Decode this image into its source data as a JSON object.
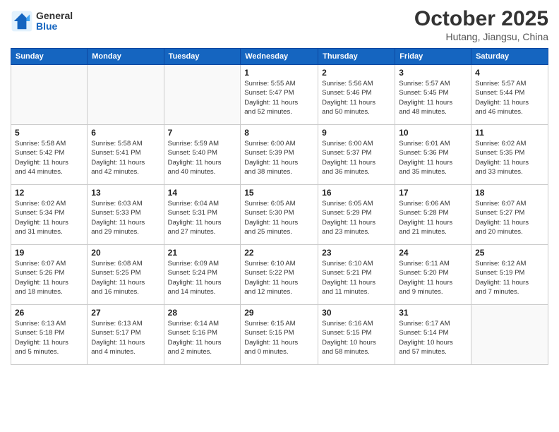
{
  "logo": {
    "general": "General",
    "blue": "Blue"
  },
  "title": "October 2025",
  "location": "Hutang, Jiangsu, China",
  "weekdays": [
    "Sunday",
    "Monday",
    "Tuesday",
    "Wednesday",
    "Thursday",
    "Friday",
    "Saturday"
  ],
  "weeks": [
    [
      {
        "day": "",
        "info": ""
      },
      {
        "day": "",
        "info": ""
      },
      {
        "day": "",
        "info": ""
      },
      {
        "day": "1",
        "info": "Sunrise: 5:55 AM\nSunset: 5:47 PM\nDaylight: 11 hours\nand 52 minutes."
      },
      {
        "day": "2",
        "info": "Sunrise: 5:56 AM\nSunset: 5:46 PM\nDaylight: 11 hours\nand 50 minutes."
      },
      {
        "day": "3",
        "info": "Sunrise: 5:57 AM\nSunset: 5:45 PM\nDaylight: 11 hours\nand 48 minutes."
      },
      {
        "day": "4",
        "info": "Sunrise: 5:57 AM\nSunset: 5:44 PM\nDaylight: 11 hours\nand 46 minutes."
      }
    ],
    [
      {
        "day": "5",
        "info": "Sunrise: 5:58 AM\nSunset: 5:42 PM\nDaylight: 11 hours\nand 44 minutes."
      },
      {
        "day": "6",
        "info": "Sunrise: 5:58 AM\nSunset: 5:41 PM\nDaylight: 11 hours\nand 42 minutes."
      },
      {
        "day": "7",
        "info": "Sunrise: 5:59 AM\nSunset: 5:40 PM\nDaylight: 11 hours\nand 40 minutes."
      },
      {
        "day": "8",
        "info": "Sunrise: 6:00 AM\nSunset: 5:39 PM\nDaylight: 11 hours\nand 38 minutes."
      },
      {
        "day": "9",
        "info": "Sunrise: 6:00 AM\nSunset: 5:37 PM\nDaylight: 11 hours\nand 36 minutes."
      },
      {
        "day": "10",
        "info": "Sunrise: 6:01 AM\nSunset: 5:36 PM\nDaylight: 11 hours\nand 35 minutes."
      },
      {
        "day": "11",
        "info": "Sunrise: 6:02 AM\nSunset: 5:35 PM\nDaylight: 11 hours\nand 33 minutes."
      }
    ],
    [
      {
        "day": "12",
        "info": "Sunrise: 6:02 AM\nSunset: 5:34 PM\nDaylight: 11 hours\nand 31 minutes."
      },
      {
        "day": "13",
        "info": "Sunrise: 6:03 AM\nSunset: 5:33 PM\nDaylight: 11 hours\nand 29 minutes."
      },
      {
        "day": "14",
        "info": "Sunrise: 6:04 AM\nSunset: 5:31 PM\nDaylight: 11 hours\nand 27 minutes."
      },
      {
        "day": "15",
        "info": "Sunrise: 6:05 AM\nSunset: 5:30 PM\nDaylight: 11 hours\nand 25 minutes."
      },
      {
        "day": "16",
        "info": "Sunrise: 6:05 AM\nSunset: 5:29 PM\nDaylight: 11 hours\nand 23 minutes."
      },
      {
        "day": "17",
        "info": "Sunrise: 6:06 AM\nSunset: 5:28 PM\nDaylight: 11 hours\nand 21 minutes."
      },
      {
        "day": "18",
        "info": "Sunrise: 6:07 AM\nSunset: 5:27 PM\nDaylight: 11 hours\nand 20 minutes."
      }
    ],
    [
      {
        "day": "19",
        "info": "Sunrise: 6:07 AM\nSunset: 5:26 PM\nDaylight: 11 hours\nand 18 minutes."
      },
      {
        "day": "20",
        "info": "Sunrise: 6:08 AM\nSunset: 5:25 PM\nDaylight: 11 hours\nand 16 minutes."
      },
      {
        "day": "21",
        "info": "Sunrise: 6:09 AM\nSunset: 5:24 PM\nDaylight: 11 hours\nand 14 minutes."
      },
      {
        "day": "22",
        "info": "Sunrise: 6:10 AM\nSunset: 5:22 PM\nDaylight: 11 hours\nand 12 minutes."
      },
      {
        "day": "23",
        "info": "Sunrise: 6:10 AM\nSunset: 5:21 PM\nDaylight: 11 hours\nand 11 minutes."
      },
      {
        "day": "24",
        "info": "Sunrise: 6:11 AM\nSunset: 5:20 PM\nDaylight: 11 hours\nand 9 minutes."
      },
      {
        "day": "25",
        "info": "Sunrise: 6:12 AM\nSunset: 5:19 PM\nDaylight: 11 hours\nand 7 minutes."
      }
    ],
    [
      {
        "day": "26",
        "info": "Sunrise: 6:13 AM\nSunset: 5:18 PM\nDaylight: 11 hours\nand 5 minutes."
      },
      {
        "day": "27",
        "info": "Sunrise: 6:13 AM\nSunset: 5:17 PM\nDaylight: 11 hours\nand 4 minutes."
      },
      {
        "day": "28",
        "info": "Sunrise: 6:14 AM\nSunset: 5:16 PM\nDaylight: 11 hours\nand 2 minutes."
      },
      {
        "day": "29",
        "info": "Sunrise: 6:15 AM\nSunset: 5:15 PM\nDaylight: 11 hours\nand 0 minutes."
      },
      {
        "day": "30",
        "info": "Sunrise: 6:16 AM\nSunset: 5:15 PM\nDaylight: 10 hours\nand 58 minutes."
      },
      {
        "day": "31",
        "info": "Sunrise: 6:17 AM\nSunset: 5:14 PM\nDaylight: 10 hours\nand 57 minutes."
      },
      {
        "day": "",
        "info": ""
      }
    ]
  ]
}
